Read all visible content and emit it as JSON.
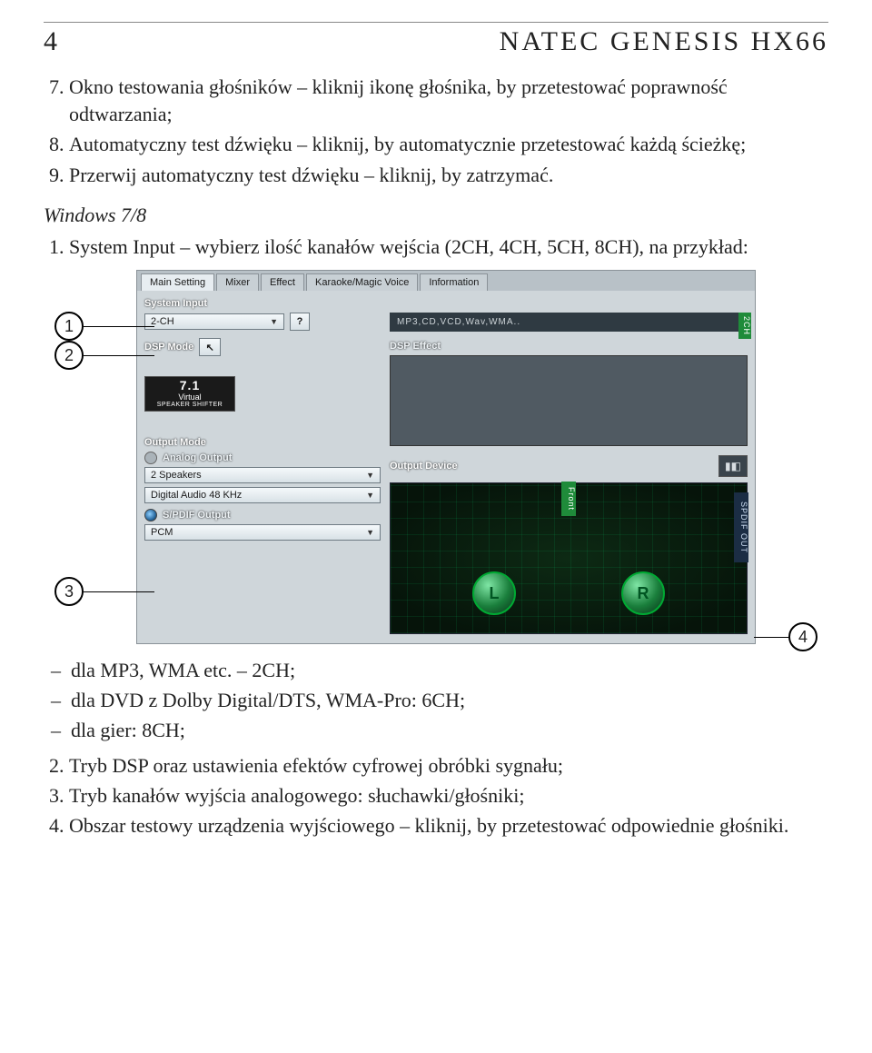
{
  "header": {
    "page_number": "4",
    "title": "NATEC GENESIS HX66"
  },
  "intro_list": {
    "item7": "Okno testowania głośników – kliknij ikonę głośnika, by przetestować poprawność odtwarzania;",
    "item8": "Automatyczny test dźwięku – kliknij, by automatycznie przetestować każdą ścieżkę;",
    "item9": "Przerwij automatyczny test dźwięku – kliknij, by zatrzymać."
  },
  "subheading": "Windows 7/8",
  "win_list": {
    "item1": "System Input – wybierz ilość kanałów wejścia (2CH, 4CH, 5CH, 8CH), na przykład:"
  },
  "callouts": {
    "c1": "1",
    "c2": "2",
    "c3": "3",
    "c4": "4"
  },
  "screenshot": {
    "tabs": {
      "main": "Main Setting",
      "mixer": "Mixer",
      "effect": "Effect",
      "karaoke": "Karaoke/Magic Voice",
      "info": "Information"
    },
    "system_input_label": "System Input",
    "system_input_value": "2-CH",
    "help": "?",
    "dsp_mode_label": "DSP Mode",
    "formats_text": "MP3,CD,VCD,Wav,WMA..",
    "vtag_2ch": "2CH",
    "dsp_effect_label": "DSP Effect",
    "virtual_badge_top": "7.1",
    "virtual_badge_mid": "Virtual",
    "virtual_badge_bot": "SPEAKER SHIFTER",
    "output_mode_label": "Output Mode",
    "analog_output_label": "Analog Output",
    "analog_output_value": "2 Speakers",
    "digital_audio_value": "Digital Audio 48 KHz",
    "spdif_label": "S/PDIF Output",
    "spdif_value": "PCM",
    "output_device_label": "Output Device",
    "front_tag": "Front",
    "spdif_tag": "SPDIF OUT",
    "spk_l": "L",
    "spk_r": "R"
  },
  "bullets": {
    "b1": "dla MP3, WMA etc. – 2CH;",
    "b2": "dla DVD z Dolby Digital/DTS, WMA-Pro: 6CH;",
    "b3": "dla gier: 8CH;"
  },
  "after_list": {
    "n2": "Tryb DSP oraz ustawienia efektów cyfrowej obróbki sygnału;",
    "n3": "Tryb kanałów wyjścia analogowego: słuchawki/głośniki;",
    "n4": "Obszar testowy urządzenia wyjściowego – kliknij, by przetestować odpowiednie głośniki."
  }
}
